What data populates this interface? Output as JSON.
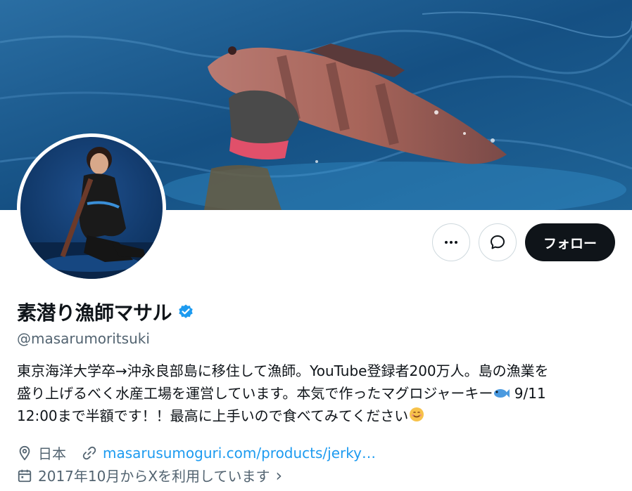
{
  "profile": {
    "display_name": "素潜り漁師マサル",
    "handle": "@masarumoritsuki",
    "verified": true,
    "bio_lines": [
      "東京海洋大学卒→沖永良部島に移住して漁師。YouTube登録者200万人。島の漁業を",
      "盛り上げるべく水産工場を運営しています。本気で作ったマグロジャーキー",
      "12:00まで半額です！！最高に上手いので食べてみてください"
    ],
    "bio_line2_tail": " 9/11",
    "location": "日本",
    "website": "masarusumoguri.com/products/jerky…",
    "joined": "2017年10月からXを利用しています",
    "chevron": "›"
  },
  "actions": {
    "more_icon": "more-icon",
    "message_icon": "message-icon",
    "follow_label": "フォロー"
  },
  "colors": {
    "accent": "#1d9bf0",
    "follow_bg": "#0f1419",
    "meta_text": "#536471",
    "verified": "#1d9bf0"
  }
}
